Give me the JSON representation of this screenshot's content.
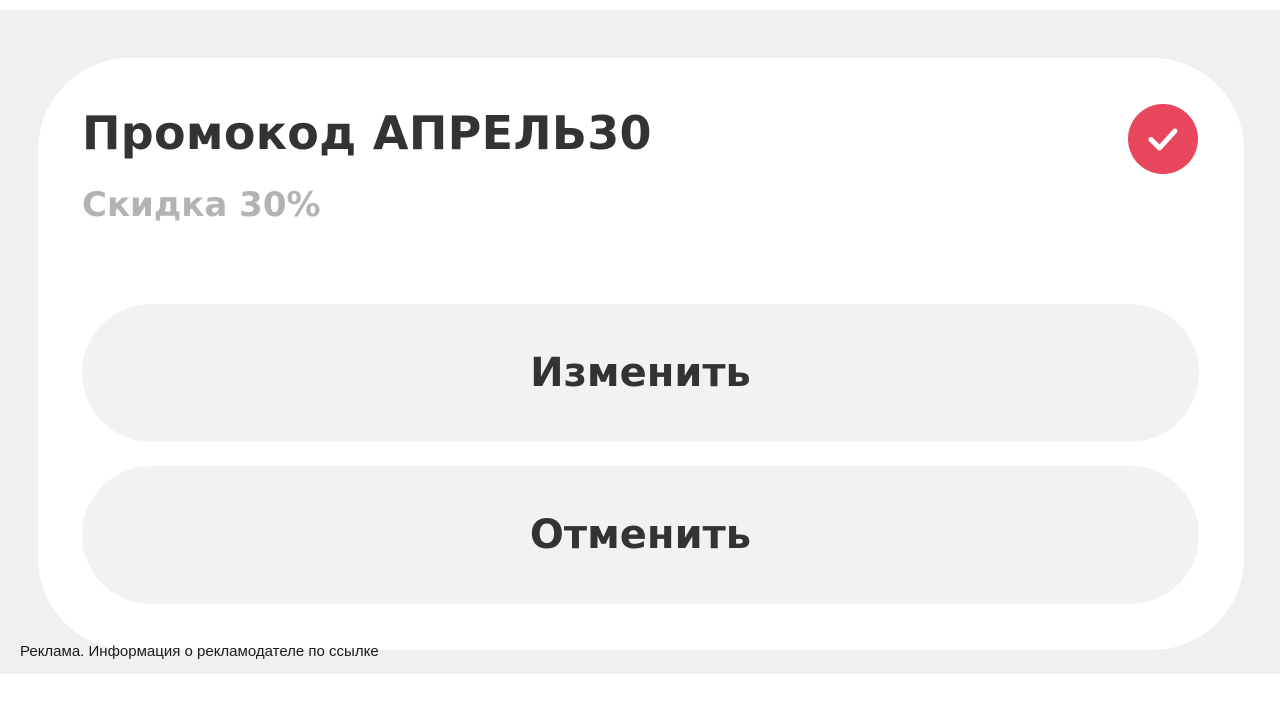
{
  "promo": {
    "title": "Промокод АПРЕЛЬ30",
    "subtitle": "Скидка 30%",
    "applied_icon": "checkmark-circle-icon",
    "applied_color": "#e8475e"
  },
  "actions": {
    "change_label": "Изменить",
    "cancel_label": "Отменить"
  },
  "footer": {
    "ad_disclaimer": "Реклама. Информация о рекламодателе по ссылке"
  }
}
